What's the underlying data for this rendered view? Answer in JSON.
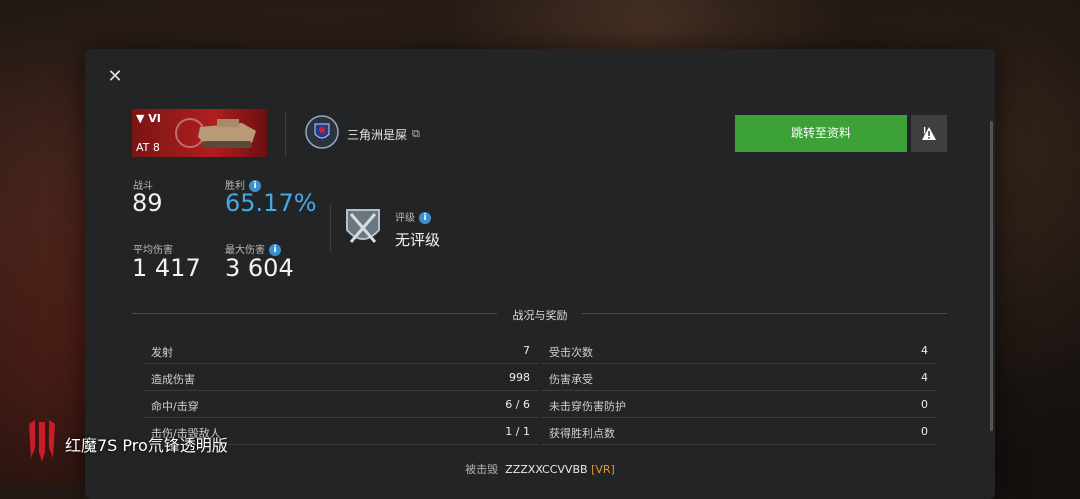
{
  "tank": {
    "tier": "▼ VI",
    "name": "AT 8"
  },
  "player": {
    "name": "三角洲是屎"
  },
  "buttons": {
    "profile": "跳转至资料",
    "warn": "!"
  },
  "stats": {
    "battles_label": "战斗",
    "battles": "89",
    "winrate_label": "胜利",
    "winrate": "65.17%",
    "avg_dmg_label": "平均伤害",
    "avg_dmg": "1 417",
    "max_dmg_label": "最大伤害",
    "max_dmg": "3 604",
    "rating_label": "评级",
    "rating": "无评级"
  },
  "section_title": "战况与奖励",
  "left_rows": [
    {
      "label": "发射",
      "value": "7"
    },
    {
      "label": "造成伤害",
      "value": "998"
    },
    {
      "label": "命中/击穿",
      "value": "6 / 6"
    },
    {
      "label": "击伤/击毁敌人",
      "value": "1 / 1"
    }
  ],
  "right_rows": [
    {
      "label": "受击次数",
      "value": "4"
    },
    {
      "label": "伤害承受",
      "value": "4"
    },
    {
      "label": "未击穿伤害防护",
      "value": "0"
    },
    {
      "label": "获得胜利点数",
      "value": "0"
    }
  ],
  "destroyed": {
    "prefix": "被击毁",
    "by": "ZZZXXCCVVBB",
    "clan": "[VR]"
  },
  "watermark": "红魔7S Pro氘锋透明版",
  "colors": {
    "green": "#3ca238",
    "blue": "#46a9e6",
    "orange": "#e19b34"
  }
}
